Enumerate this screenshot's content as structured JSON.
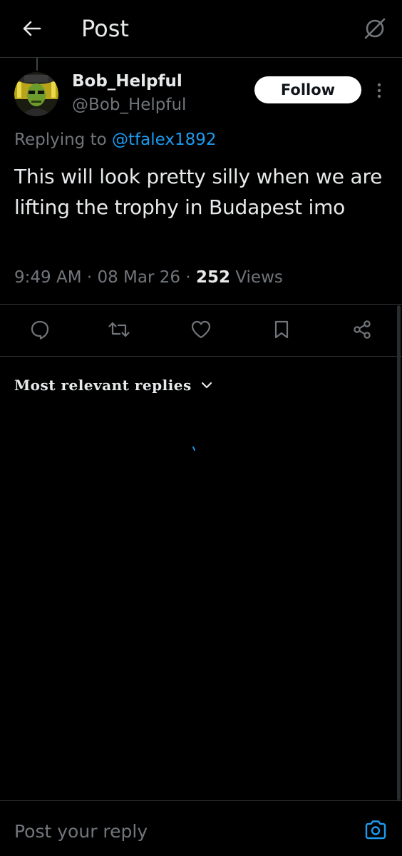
{
  "header": {
    "title": "Post",
    "back_icon": "arrow-left-icon",
    "grok_icon": "grok-icon"
  },
  "author": {
    "name": "Bob_Helpful",
    "handle": "@Bob_Helpful",
    "avatar_icon": "avatar-image",
    "follow_label": "Follow",
    "more_icon": "more-vertical-icon"
  },
  "reply_context": {
    "prefix": "Replying to ",
    "mention": "@tfalex1892"
  },
  "post": {
    "text": "This will look pretty silly when we are lifting the trophy in Budapest imo",
    "time": "9:49 AM",
    "date": "08 Mar 26",
    "views_count": "252",
    "views_label": "Views"
  },
  "actions": [
    {
      "name": "reply",
      "icon": "comment-icon"
    },
    {
      "name": "repost",
      "icon": "repost-icon"
    },
    {
      "name": "like",
      "icon": "heart-icon"
    },
    {
      "name": "bookmark",
      "icon": "bookmark-icon"
    },
    {
      "name": "share",
      "icon": "share-icon"
    }
  ],
  "replies": {
    "sort_label": "Most relevant replies",
    "sort_icon": "chevron-down-icon"
  },
  "reply_bar": {
    "placeholder": "Post your reply",
    "camera_icon": "camera-icon"
  },
  "colors": {
    "background": "#000000",
    "text": "#e7e9ea",
    "secondary_text": "#71767b",
    "accent": "#1d9bf0",
    "divider": "#2f3336"
  }
}
